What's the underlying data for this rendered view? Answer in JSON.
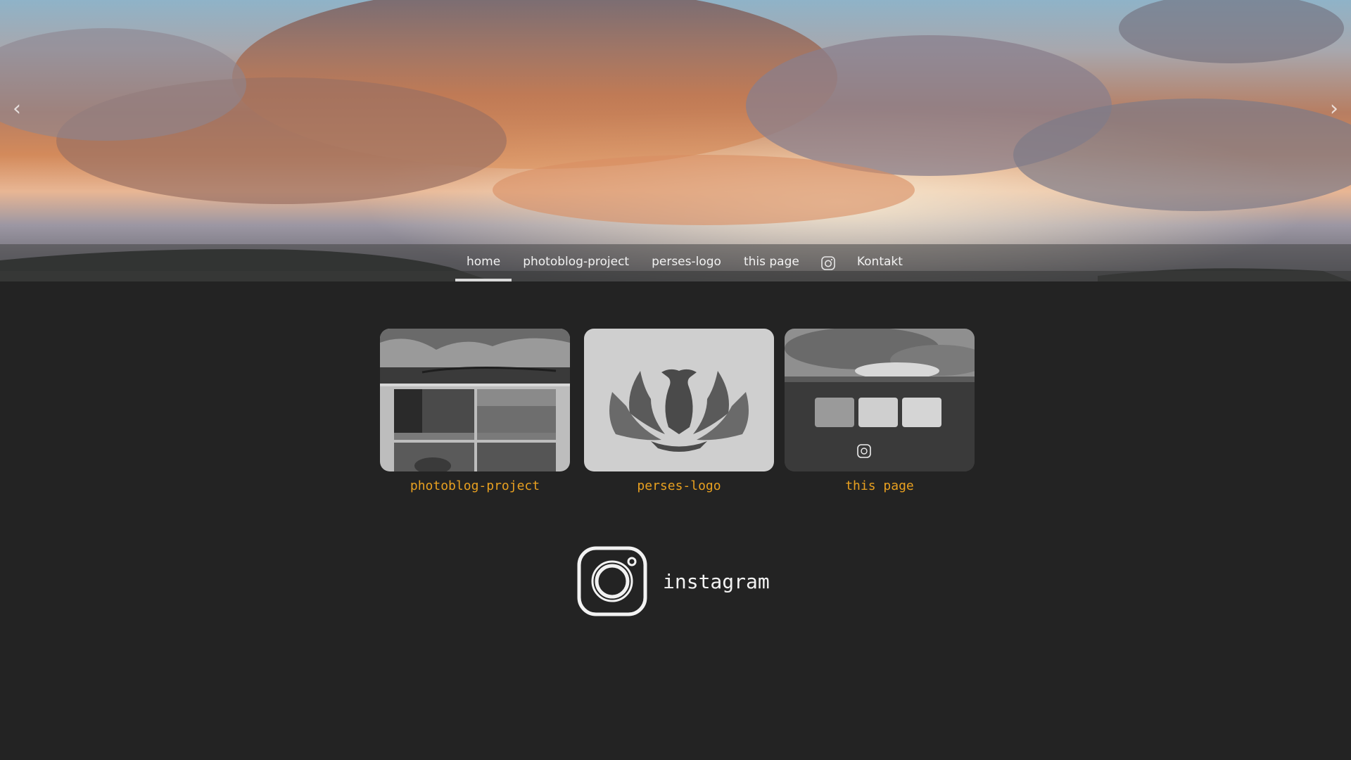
{
  "hero": {
    "prev_arrow": "‹",
    "next_arrow": "›"
  },
  "nav": {
    "items": [
      {
        "label": "home",
        "active": true
      },
      {
        "label": "photoblog-project",
        "active": false
      },
      {
        "label": "perses-logo",
        "active": false
      },
      {
        "label": "this page",
        "active": false
      },
      {
        "label": "Kontakt",
        "active": false
      }
    ],
    "instagram_icon": "instagram-icon"
  },
  "cards": [
    {
      "caption": "photoblog-project",
      "icon": "photoblog-thumbnail"
    },
    {
      "caption": "perses-logo",
      "icon": "phoenix-logo"
    },
    {
      "caption": "this page",
      "icon": "page-thumbnail"
    }
  ],
  "instagram": {
    "label": "instagram",
    "icon": "instagram-icon"
  },
  "colors": {
    "background": "#232323",
    "accent": "#e8a020",
    "nav_text": "#f2f2f2"
  }
}
